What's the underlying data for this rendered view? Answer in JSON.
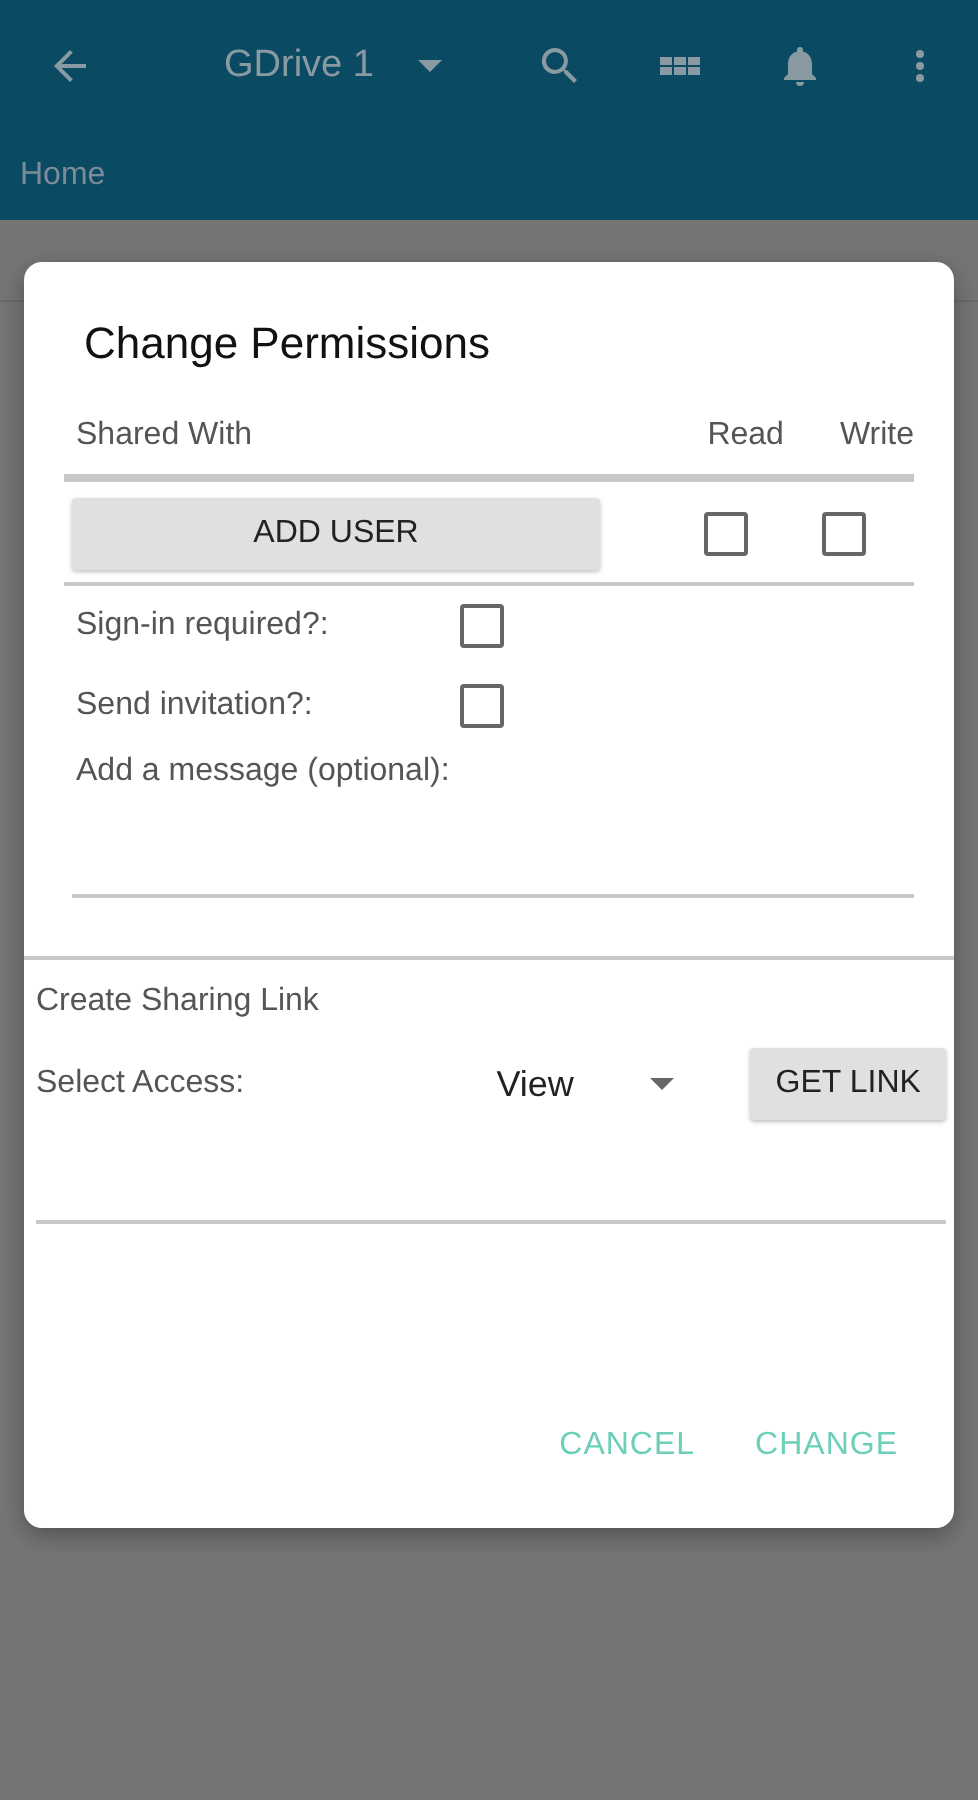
{
  "app_bar": {
    "title": "GDrive 1"
  },
  "breadcrumb": "Home",
  "dialog": {
    "title": "Change Permissions",
    "shared_with": {
      "label": "Shared With",
      "columns": [
        "Read",
        "Write"
      ],
      "add_user_button": "ADD USER",
      "read_checked": false,
      "write_checked": false
    },
    "options": [
      {
        "label": "Sign-in required?:",
        "checked": false
      },
      {
        "label": "Send invitation?:",
        "checked": false
      }
    ],
    "message_label": "Add a message (optional):",
    "sharing_link": {
      "heading": "Create Sharing Link",
      "access_label": "Select Access:",
      "access_value": "View",
      "button": "GET LINK"
    },
    "actions": [
      "CANCEL",
      "CHANGE"
    ]
  }
}
